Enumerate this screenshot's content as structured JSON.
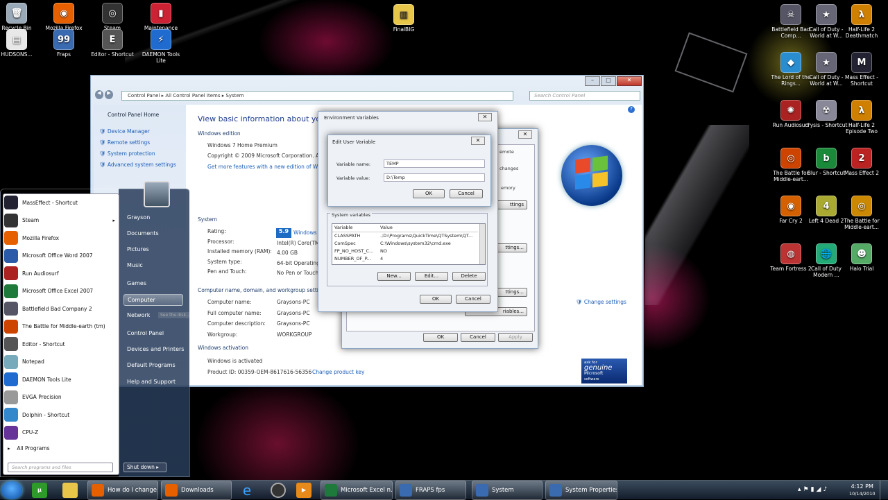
{
  "desktop": {
    "left": [
      {
        "label": "Recycle Bin",
        "color": "#9aa9b8",
        "glyph": "🗑"
      },
      {
        "label": "HUDSONS...",
        "color": "#e8e8e8",
        "glyph": "▤"
      },
      {
        "label": "Mozilla Firefox",
        "color": "#e66000",
        "glyph": "◉"
      },
      {
        "label": "Fraps",
        "color": "#3a6ab0",
        "glyph": "99"
      },
      {
        "label": "Steam",
        "color": "#333",
        "glyph": "◎"
      },
      {
        "label": "Editor - Shortcut",
        "color": "#555",
        "glyph": "E"
      },
      {
        "label": "Maintenance",
        "color": "#c23",
        "glyph": "▮"
      },
      {
        "label": "DAEMON Tools Lite",
        "color": "#1f6bd0",
        "glyph": "⚡"
      }
    ],
    "right": [
      {
        "label": "Battlefield Bad Comp...",
        "color": "#556",
        "glyph": "☠"
      },
      {
        "label": "Call of Duty - World at W...",
        "color": "#667",
        "glyph": "★"
      },
      {
        "label": "Half-Life 2 Deathmatch",
        "color": "#d08000",
        "glyph": "λ"
      },
      {
        "label": "The Lord of the Rings...",
        "color": "#2a8dd0",
        "glyph": "◆"
      },
      {
        "label": "Call of Duty - World at W...",
        "color": "#667",
        "glyph": "★"
      },
      {
        "label": "Mass Effect - Shortcut",
        "color": "#223",
        "glyph": "M"
      },
      {
        "label": "Run Audiosurf",
        "color": "#a22",
        "glyph": "✺"
      },
      {
        "label": "crysis - Shortcut",
        "color": "#889",
        "glyph": "☢"
      },
      {
        "label": "Half-Life 2 Episode Two",
        "color": "#d08000",
        "glyph": "λ"
      },
      {
        "label": "The Battle for Middle-eart...",
        "color": "#c40",
        "glyph": "◎"
      },
      {
        "label": "Blur - Shortcut",
        "color": "#1a8a3a",
        "glyph": "b"
      },
      {
        "label": "Mass Effect 2",
        "color": "#b22",
        "glyph": "2"
      },
      {
        "label": "Far Cry 2",
        "color": "#d46000",
        "glyph": "◉"
      },
      {
        "label": "Left 4 Dead 2",
        "color": "#aa3",
        "glyph": "4"
      },
      {
        "label": "The Battle for Middle-eart...",
        "color": "#c80",
        "glyph": "◎"
      },
      {
        "label": "Team Fortress 2",
        "color": "#b33",
        "glyph": "◍"
      },
      {
        "label": "Call of Duty Modern ...",
        "color": "#2a7",
        "glyph": "🌐"
      },
      {
        "label": "Halo Trial",
        "color": "#5a6",
        "glyph": "☻"
      }
    ],
    "center": {
      "label": "FinalBIG"
    }
  },
  "system_window": {
    "breadcrumb": [
      "Control Panel",
      "All Control Panel Items",
      "System"
    ],
    "search_placeholder": "Search Control Panel",
    "left_links": [
      "Control Panel Home",
      "Device Manager",
      "Remote settings",
      "System protection",
      "Advanced system settings"
    ],
    "title": "View basic information about your co",
    "windows_edition": "Windows edition",
    "edition": "Windows 7 Home Premium",
    "copyright": "Copyright © 2009 Microsoft Corporation. All",
    "more_features": "Get more features with a new edition of Wind",
    "system_heading": "System",
    "rows": [
      {
        "k": "Rating:",
        "v": "Windows E"
      },
      {
        "k": "Processor:",
        "v": "Intel(R) Core(TM"
      },
      {
        "k": "Installed memory (RAM):",
        "v": "4.00 GB"
      },
      {
        "k": "System type:",
        "v": "64-bit Operating"
      },
      {
        "k": "Pen and Touch:",
        "v": "No Pen or Touch"
      }
    ],
    "rating_badge": "5.9",
    "cn_heading": "Computer name, domain, and workgroup setting",
    "cn_rows": [
      {
        "k": "Computer name:",
        "v": "Graysons-PC"
      },
      {
        "k": "Full computer name:",
        "v": "Graysons-PC"
      },
      {
        "k": "Computer description:",
        "v": "Graysons-PC"
      },
      {
        "k": "Workgroup:",
        "v": "WORKGROUP"
      }
    ],
    "activation_heading": "Windows activation",
    "activated": "Windows is activated",
    "product_id": "Product ID: 00359-OEM-8617616-56356",
    "change_key": "Change product key",
    "change_settings": "Change settings",
    "genuine": [
      "ask for",
      "genuine",
      "Microsoft",
      "software"
    ],
    "tooltip": "See the disk..."
  },
  "sys_props": {
    "ok": "OK",
    "cancel": "Cancel",
    "apply": "Apply",
    "tab_fragment": "emote",
    "frag1": "changes",
    "frag2": "emory",
    "frag3": "ttings",
    "frag4": "ttings...",
    "frag5": "ttings...",
    "frag6": "riables..."
  },
  "env_vars": {
    "title": "Environment Variables",
    "system_vars_label": "System variables",
    "columns": [
      "Variable",
      "Value"
    ],
    "rows": [
      {
        "var": "CLASSPATH",
        "val": ".;D:\\Programs\\QuickTime\\QTSystem\\QT..."
      },
      {
        "var": "ComSpec",
        "val": "C:\\Windows\\system32\\cmd.exe"
      },
      {
        "var": "FP_NO_HOST_C...",
        "val": "NO"
      },
      {
        "var": "NUMBER_OF_P...",
        "val": "4"
      }
    ],
    "new": "New...",
    "edit": "Edit...",
    "delete": "Delete",
    "ok": "OK",
    "cancel": "Cancel"
  },
  "edit_var": {
    "title": "Edit User Variable",
    "name_label": "Variable name:",
    "name_value": "TEMP",
    "value_label": "Variable value:",
    "value_value": "D:\\Temp",
    "ok": "OK",
    "cancel": "Cancel"
  },
  "start_menu": {
    "items": [
      {
        "label": "MassEffect - Shortcut",
        "color": "#223",
        "arrow": false
      },
      {
        "label": "Steam",
        "color": "#333",
        "arrow": true
      },
      {
        "label": "Mozilla Firefox",
        "color": "#e66000",
        "arrow": false
      },
      {
        "label": "Microsoft Office Word 2007",
        "color": "#2a5aa8",
        "arrow": false
      },
      {
        "label": "Run Audiosurf",
        "color": "#a22",
        "arrow": false
      },
      {
        "label": "Microsoft Office Excel 2007",
        "color": "#1e7a3a",
        "arrow": false
      },
      {
        "label": "Battlefield Bad Company 2",
        "color": "#556",
        "arrow": false
      },
      {
        "label": "The Battle for Middle-earth (tm)",
        "color": "#c40",
        "arrow": false
      },
      {
        "label": "Editor - Shortcut",
        "color": "#555",
        "arrow": false
      },
      {
        "label": "Notepad",
        "color": "#7ab",
        "arrow": false
      },
      {
        "label": "DAEMON Tools Lite",
        "color": "#1f6bd0",
        "arrow": false
      },
      {
        "label": "EVGA Precision",
        "color": "#999",
        "arrow": false
      },
      {
        "label": "Dolphin - Shortcut",
        "color": "#38c",
        "arrow": false
      },
      {
        "label": "CPU-Z",
        "color": "#639",
        "arrow": false
      }
    ],
    "all_programs": "All Programs",
    "search_placeholder": "Search programs and files",
    "right": [
      "Grayson",
      "Documents",
      "Pictures",
      "Music",
      "Games",
      "Computer",
      "Network",
      "Control Panel",
      "Devices and Printers",
      "Default Programs",
      "Help and Support"
    ],
    "shutdown": "Shut down"
  },
  "taskbar": {
    "buttons": [
      {
        "label": "How do I change ...",
        "color": "#e66000"
      },
      {
        "label": "Downloads",
        "color": "#e66000"
      },
      {
        "label": "Microsoft Excel n...",
        "color": "#1e7a3a"
      },
      {
        "label": "FRAPS fps",
        "color": "#3a6ab0"
      },
      {
        "label": "System",
        "color": "#3a6ab0"
      },
      {
        "label": "System Properties",
        "color": "#3a6ab0"
      }
    ],
    "pinned": [
      "utorrent-icon",
      "folder-icon",
      "ie-icon",
      "steam-icon",
      "media-player-icon"
    ],
    "time": "4:12 PM",
    "date": "10/14/2010"
  }
}
